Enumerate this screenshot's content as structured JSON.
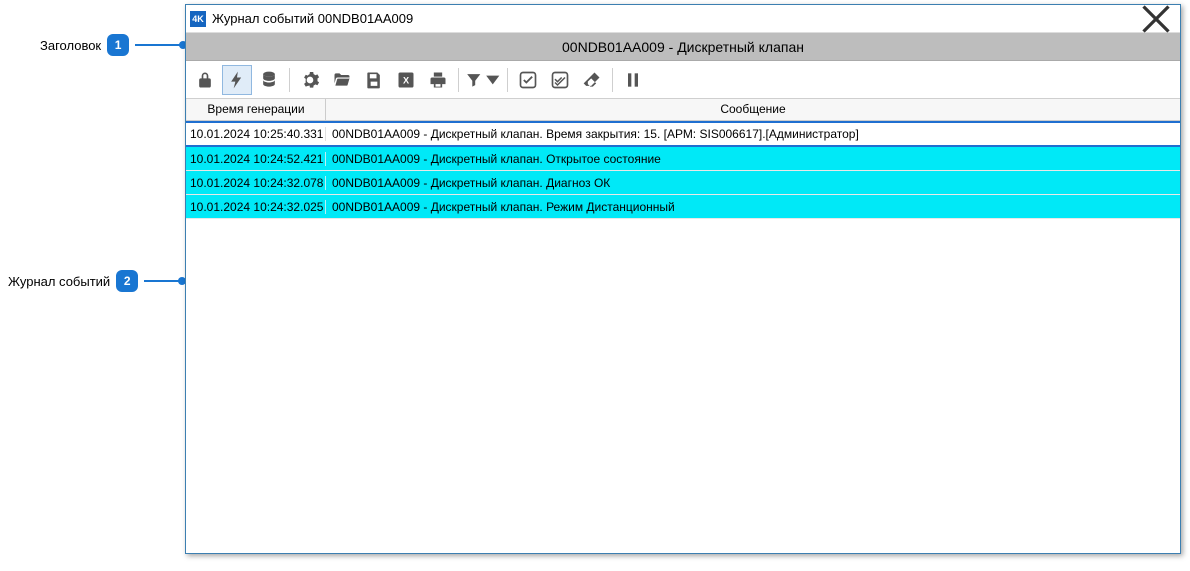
{
  "callouts": {
    "c1": "Заголовок",
    "c2": "Журнал событий"
  },
  "window": {
    "title": "Журнал событий 00NDB01AA009",
    "subtitle": "00NDB01AA009 - Дискретный клапан"
  },
  "columns": {
    "time": "Время генерации",
    "message": "Сообщение"
  },
  "rows": [
    {
      "time": "10.01.2024 10:25:40.331",
      "msg": "00NDB01AA009 - Дискретный клапан. Время закрытия: 15. [АРМ: SIS006617].[Администратор]",
      "selected": true,
      "highlight": false
    },
    {
      "time": "10.01.2024 10:24:52.421",
      "msg": "00NDB01AA009 - Дискретный клапан. Открытое состояние",
      "selected": false,
      "highlight": true
    },
    {
      "time": "10.01.2024 10:24:32.078",
      "msg": "00NDB01AA009 - Дискретный клапан. Диагноз ОК",
      "selected": false,
      "highlight": true
    },
    {
      "time": "10.01.2024 10:24:32.025",
      "msg": "00NDB01AA009 - Дискретный клапан. Режим Дистанционный",
      "selected": false,
      "highlight": true
    }
  ],
  "toolbar": [
    {
      "name": "lock-icon",
      "active": false
    },
    {
      "name": "bolt-icon",
      "active": true
    },
    {
      "name": "database-icon",
      "active": false
    },
    {
      "sep": true
    },
    {
      "name": "gear-icon",
      "active": false
    },
    {
      "name": "folder-open-icon",
      "active": false
    },
    {
      "name": "save-icon",
      "active": false
    },
    {
      "name": "excel-icon",
      "active": false
    },
    {
      "name": "print-icon",
      "active": false
    },
    {
      "sep": true
    },
    {
      "name": "filter-icon",
      "active": false
    },
    {
      "sep": true
    },
    {
      "name": "check-single-icon",
      "active": false
    },
    {
      "name": "check-all-icon",
      "active": false
    },
    {
      "name": "eraser-icon",
      "active": false
    },
    {
      "sep": true
    },
    {
      "name": "pause-icon",
      "active": false
    }
  ]
}
